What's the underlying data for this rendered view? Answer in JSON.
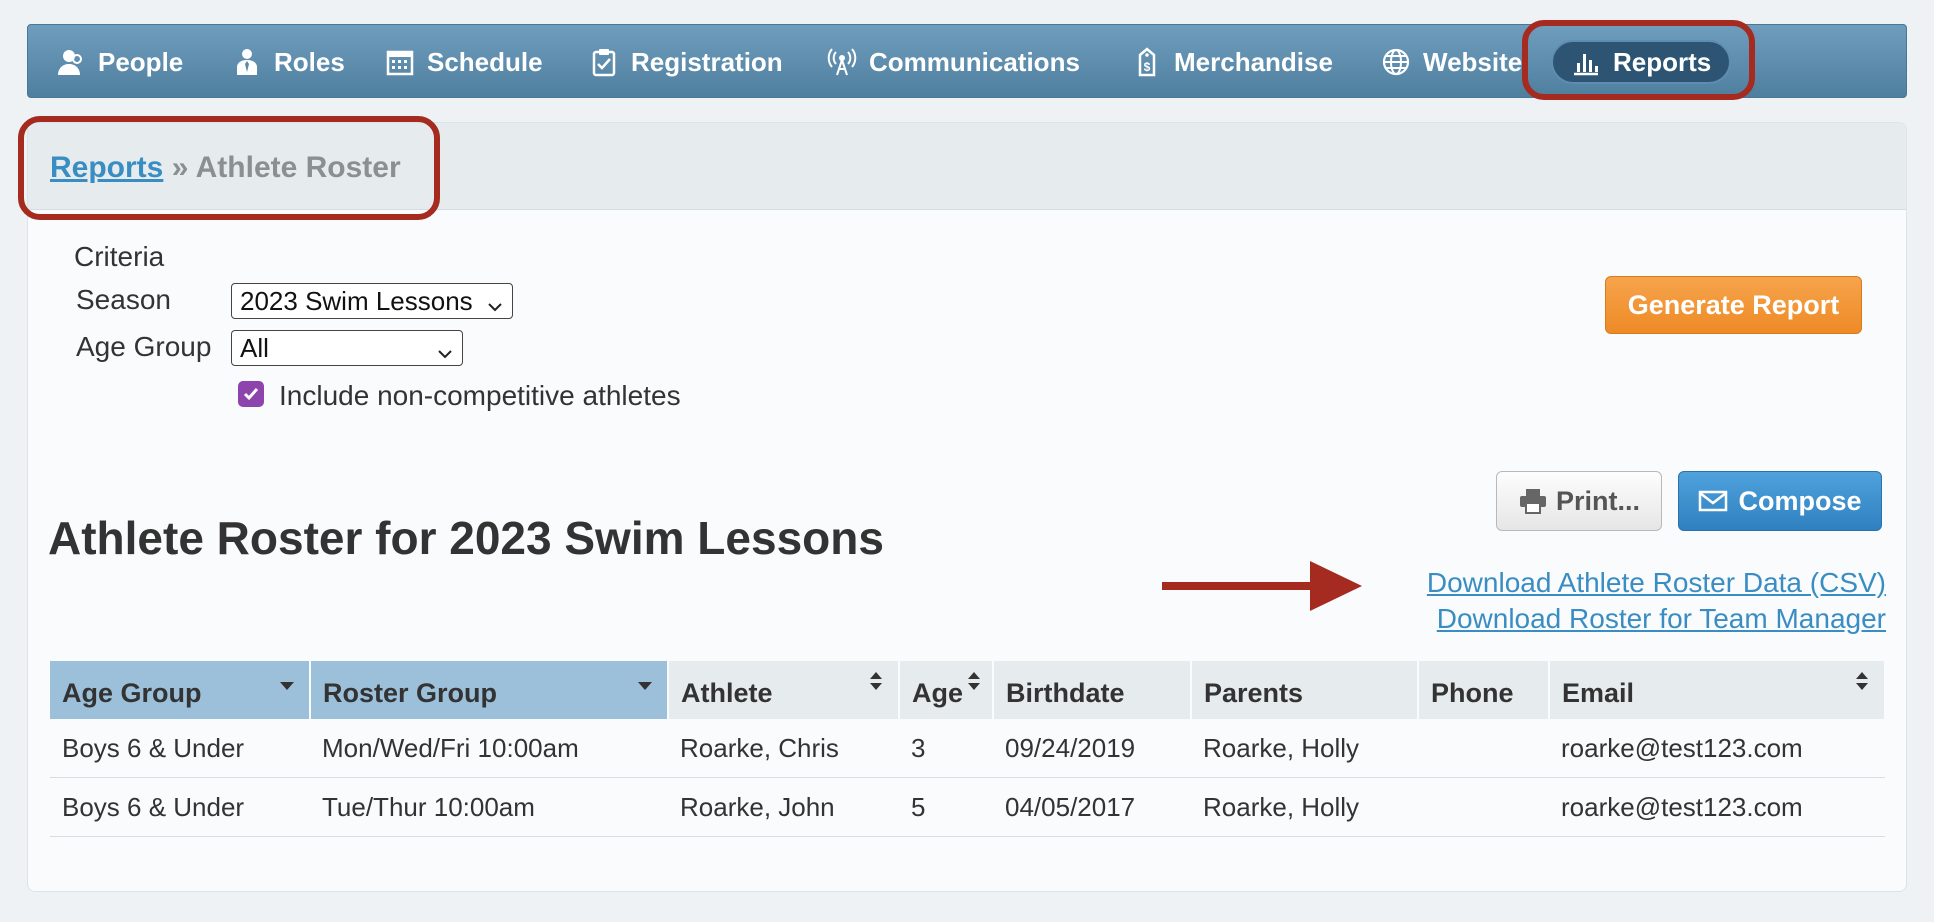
{
  "nav": {
    "items": [
      {
        "label": "People",
        "icon": "person-icon"
      },
      {
        "label": "Roles",
        "icon": "role-icon"
      },
      {
        "label": "Schedule",
        "icon": "calendar-icon"
      },
      {
        "label": "Registration",
        "icon": "clipboard-check-icon"
      },
      {
        "label": "Communications",
        "icon": "broadcast-icon"
      },
      {
        "label": "Merchandise",
        "icon": "price-tag-icon"
      },
      {
        "label": "Website",
        "icon": "globe-icon"
      },
      {
        "label": "Reports",
        "icon": "bar-chart-icon",
        "active": true
      }
    ]
  },
  "breadcrumb": {
    "root": "Reports",
    "separator": "»",
    "current": "Athlete Roster"
  },
  "criteria": {
    "heading": "Criteria",
    "season_label": "Season",
    "season_value": "2023 Swim Lessons",
    "age_group_label": "Age Group",
    "age_group_value": "All",
    "noncompetitive_label": "Include non-competitive athletes",
    "noncompetitive_checked": true
  },
  "buttons": {
    "generate": "Generate Report",
    "print": "Print...",
    "compose": "Compose"
  },
  "report": {
    "title": "Athlete Roster for 2023 Swim Lessons",
    "download_csv": "Download Athlete Roster Data (CSV)",
    "download_team_manager": "Download Roster for Team Manager"
  },
  "table": {
    "columns": [
      "Age Group",
      "Roster Group",
      "Athlete",
      "Age",
      "Birthdate",
      "Parents",
      "Phone",
      "Email"
    ],
    "rows": [
      [
        "Boys 6 & Under",
        "Mon/Wed/Fri 10:00am",
        "Roarke, Chris",
        "3",
        "09/24/2019",
        "Roarke, Holly",
        "",
        "roarke@test123.com"
      ],
      [
        "Boys 6 & Under",
        "Tue/Thur 10:00am",
        "Roarke, John",
        "5",
        "04/05/2017",
        "Roarke, Holly",
        "",
        "roarke@test123.com"
      ]
    ]
  },
  "colors": {
    "accent_red": "#a52a1f",
    "link_blue": "#3a8dc3",
    "nav_blue": "#5b8aab",
    "orange": "#f0922f",
    "checkbox_purple": "#8e44ad"
  }
}
